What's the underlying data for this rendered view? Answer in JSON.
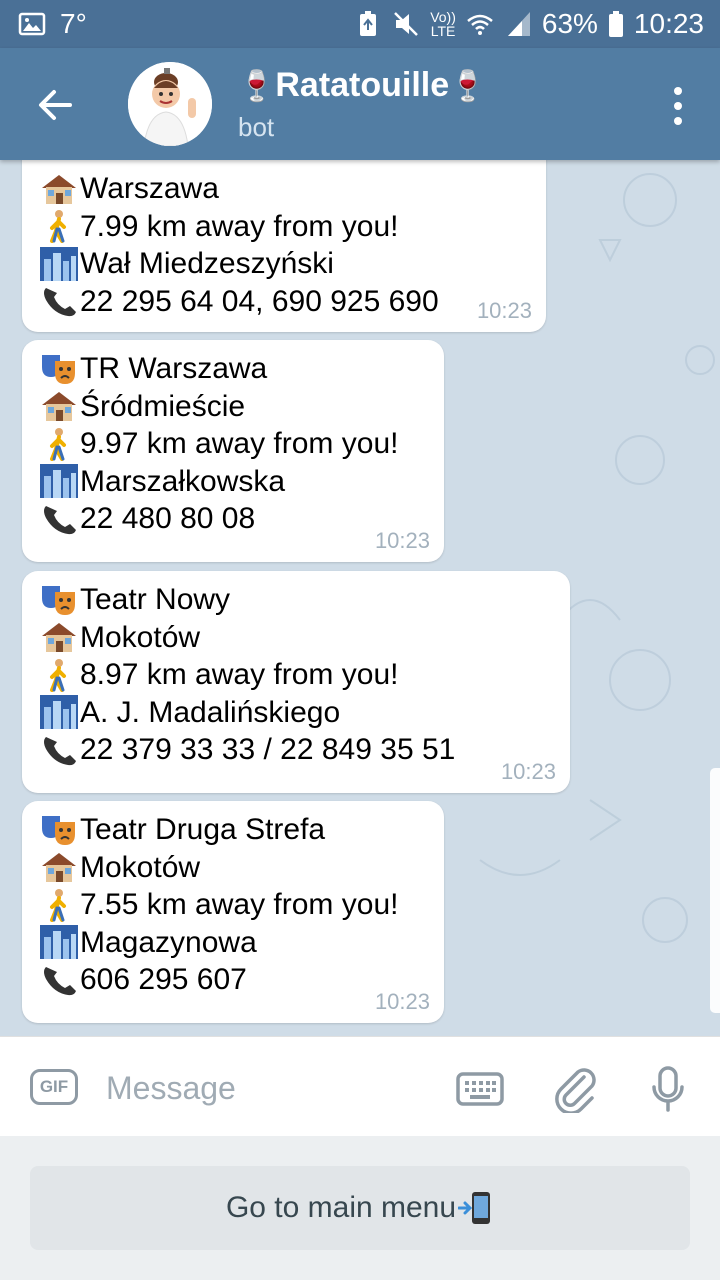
{
  "status_bar": {
    "temperature": "7°",
    "network": "LTE",
    "battery": "63%",
    "time": "10:23"
  },
  "header": {
    "title": "Ratatouille",
    "subtitle": "bot",
    "title_emoji": "wine-glass"
  },
  "messages": [
    {
      "name_partial": "",
      "district": "Warszawa",
      "distance": "7.99 km away from you!",
      "street": " Wał Miedzeszyński",
      "phone": "22 295 64 04, 690 925 690",
      "time": "10:23"
    },
    {
      "name": "TR Warszawa",
      "district": "Śródmieście",
      "distance": "9.97 km away from you!",
      "street": "Marszałkowska",
      "phone": "22 480 80 08",
      "time": "10:23"
    },
    {
      "name": "Teatr Nowy",
      "district": "Mokotów",
      "distance": "8.97 km away from you!",
      "street": "A. J. Madalińskiego",
      "phone": "22 379 33 33 / 22 849 35 51",
      "time": "10:23"
    },
    {
      "name": "Teatr Druga Strefa",
      "district": "Mokotów",
      "distance": "7.55 km away from you!",
      "street": "Magazynowa",
      "phone": "606 295 607",
      "time": "10:23"
    }
  ],
  "input": {
    "gif_label": "GIF",
    "placeholder": "Message",
    "value": ""
  },
  "bot_keyboard": {
    "main_menu_label": "Go to main menu"
  },
  "colors": {
    "header": "#527da3",
    "status_bar": "#4a7096",
    "chat_background": "#cfdce7",
    "bubble": "#ffffff",
    "timestamp": "#a3b1bd"
  },
  "icons": {
    "theater": "performing-arts-icon",
    "district": "house-icon",
    "distance": "walking-person-icon",
    "street": "city-icon",
    "phone": "telephone-icon"
  }
}
